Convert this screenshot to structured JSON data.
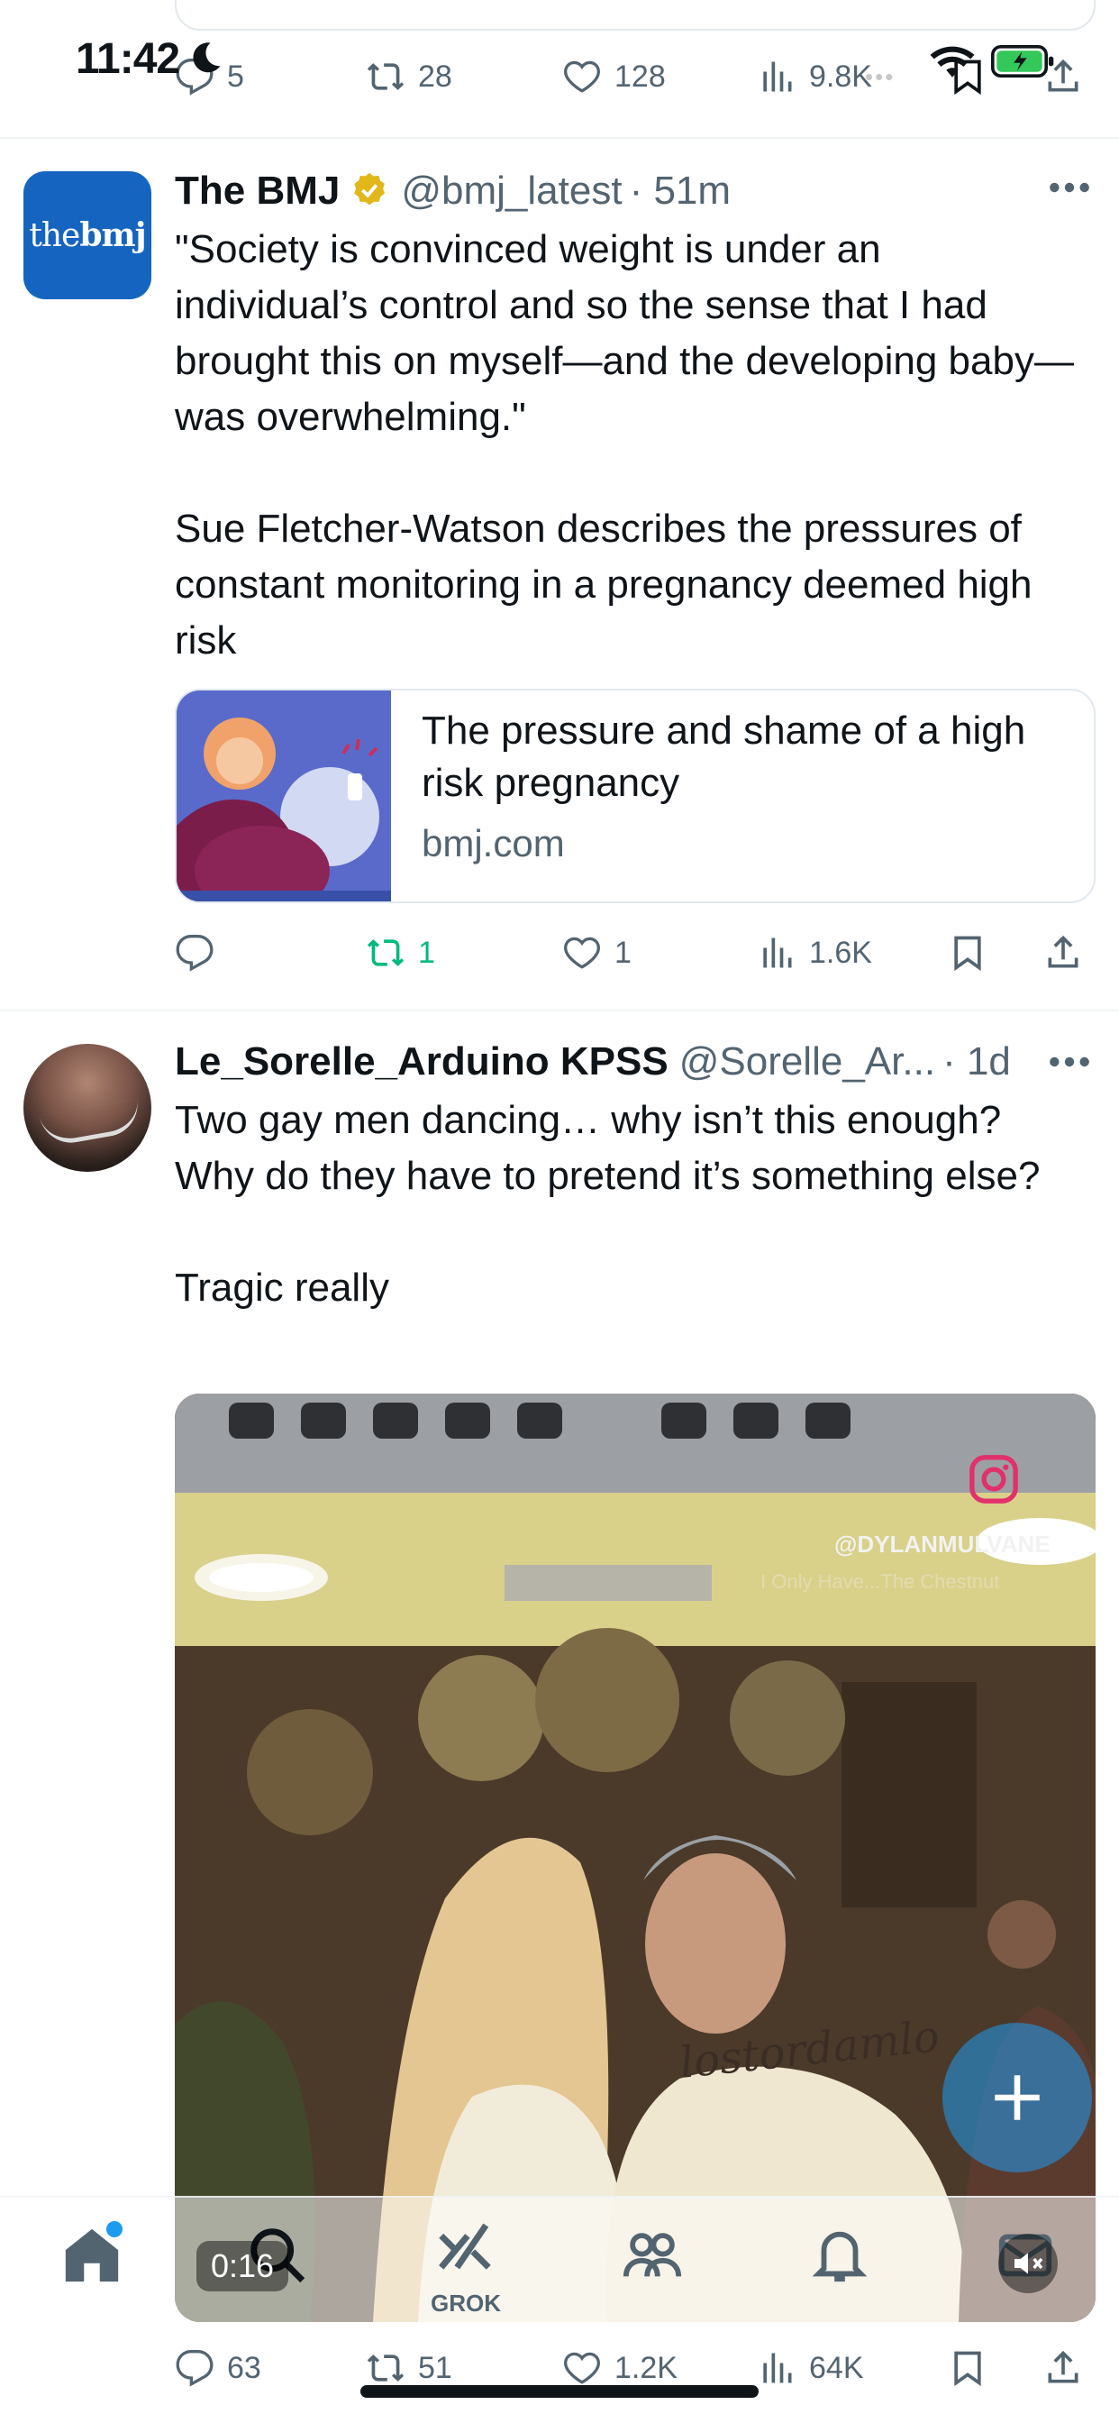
{
  "status_bar": {
    "time": "11:42"
  },
  "previous_tweet": {
    "actions": {
      "replies": "5",
      "reposts": "28",
      "likes": "128",
      "views": "9.8K"
    }
  },
  "tweets": [
    {
      "display_name": "The BMJ",
      "handle": "@bmj_latest",
      "time": "· 51m",
      "avatar_text_regular": "the",
      "avatar_text_bold": "bmj",
      "text": "\"Society is convinced weight is under an individual’s control and so the sense that I had brought this on myself—and the developing baby—was overwhelming.\"\n\nSue Fletcher-Watson describes the pressures of constant monitoring in a pregnancy deemed high risk",
      "card": {
        "title": "The pressure and shame of a high risk pregnancy",
        "domain": "bmj.com"
      },
      "actions": {
        "replies": "",
        "reposts": "1",
        "likes": "1",
        "views": "1.6K"
      }
    },
    {
      "display_name": "Le_Sorelle_Arduino KPSS",
      "handle": "@Sorelle_Ar...",
      "time": "· 1d",
      "text": "Two gay men dancing… why isn’t this enough? Why do they have to pretend it’s something else?\n\nTragic really",
      "video": {
        "watermark_handle": "@DYLANMULVANE",
        "song": "I Only Have...The Chestnut",
        "shirt_text": "lostordamlo",
        "time": "0:16"
      },
      "actions": {
        "replies": "63",
        "reposts": "51",
        "likes": "1.2K",
        "views": "64K"
      }
    }
  ],
  "bottom_nav": {
    "grok_label": "GROK",
    "items": [
      "home",
      "search",
      "grok",
      "communities",
      "notifications",
      "messages"
    ]
  },
  "colors": {
    "accent": "#1d9bf0",
    "repost_active": "#00ba7c",
    "secondary_text": "#536471",
    "verified_gold": "#e2b719",
    "bmj_blue": "#1565c0"
  }
}
